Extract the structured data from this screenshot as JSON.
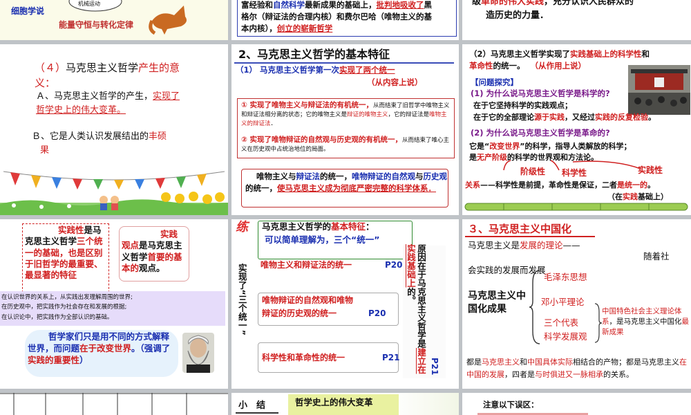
{
  "s1": {
    "cell_left": "细胞学说",
    "cell_right": "能量守恒与转化定律",
    "small_caption": "机械运动"
  },
  "s2": {
    "line1_a": "富经验和",
    "line1_b": "自然科学",
    "line1_c": "最新成果的基础上，",
    "line1_d": "批判地吸收了",
    "line1_e": "黑",
    "line2": "格尔（辩证法的合理内核）和费尔巴哈（唯物主义的基",
    "line3_a": "本内核），",
    "line3_b": "创立的崭新哲学"
  },
  "s3": {
    "line1_a": "级",
    "line1_b": "革命的伟大实践",
    "line1_c": "，充分认识人民群众的",
    "line2": "造历史的力量．"
  },
  "s4": {
    "title_a": "（４）",
    "title_b": "马克思主义哲学",
    "title_c": "产生的意",
    "title_d": "义：",
    "a_pre": "Ａ、马克思主义哲学的产生，",
    "a_red1": "实现了",
    "a_red2": "哲学史上的伟大变革。",
    "b_pre": "Ｂ、它是人类认识发展结出的",
    "b_red1": "丰硕",
    "b_red2": "果"
  },
  "s5": {
    "heading": "2、马克思主义哲学的基本特征",
    "sub_num": "（1）",
    "sub_a": "马克思主义哲学第一次",
    "sub_b": "实现了两个统一",
    "sub_note": "（从内容上说）",
    "p1_title": "① 实现了唯物主义与辩证法的有机统一，",
    "p1_body1": "从而结束了旧哲学中唯物主义和辩证法相分离的状态；它的唯物主义是",
    "p1_red1": "辩证的唯物主义",
    "p1_body2": "，它的辩证法是",
    "p1_red2": "唯物主义的辩证法",
    "p1_end": "．",
    "p2_title": "② 实现了唯物辩证的自然观与历史观的有机统一，",
    "p2_body": "从而结束了唯心主义在历史观中占统治地位的局面。",
    "p3_a": "唯物主义",
    "p3_b": "与",
    "p3_c": "辩证法",
    "p3_d": "的统一，",
    "p3_e": "唯物辩证的自然观",
    "p3_f": "与",
    "p3_g": "历史观",
    "p3_h": "的统一，",
    "p3_i": "使马克思主义成为彻底严密完整的科学体系．"
  },
  "s6": {
    "line1_a": "（2）马克思主义哲学实现了",
    "line1_b": "实践基础上的",
    "line1_c": "科学性",
    "line1_d": "和",
    "line2_a": "革命性",
    "line2_b": "的统一。",
    "line2_c": "（从作用上说）",
    "qtitle": "【问题探究】",
    "q1": "(1) 为什么说马克思主义哲学是科学的?",
    "a1": "在于它坚持科学的实践观点；",
    "a2_a": "在于它的全部理论",
    "a2_b": "源于实践",
    "a2_c": "，又经过",
    "a2_d": "实践的反复检验",
    "a2_e": "。",
    "q2": "(2) 为什么说马克思主义哲学是革命的?",
    "r1_a": "它是“",
    "r1_b": "改变世界",
    "r1_c": "”的科学，指导人类解放的科学；",
    "r2_a": "是",
    "r2_b": "无产阶级",
    "r2_c": "的科学的世界观和方法论。",
    "lab1": "阶级性",
    "lab2": "科学性",
    "lab3": "实践性",
    "rel_a": "关系",
    "rel_b": "——科学性是前提，革命性是保证，二者",
    "rel_c": "是统一的",
    "rel_d": "。",
    "rel_e": "（在",
    "rel_f": "实践",
    "rel_g": "基础上）"
  },
  "s7": {
    "b1_a": "实践性",
    "b1_b": "是",
    "b1_c": "马克思主义哲学",
    "b1_d": "三个统一的基础，也是区别于旧哲学的最重要、最显著的特征",
    "b2_a": "实践",
    "b2_b": "观点",
    "b2_c": "是马克思主义哲学",
    "b2_d": "首要的基本的",
    "b2_e": "观点。",
    "l1": "在认识世界的关系上，从实践出发理解周围的世界;",
    "l2": "在历史观中，把实践作为社会存在和发展的根据;",
    "l3": "在认识论中，把实践作为全部认识的基础。",
    "q_a": "哲学家们只是用不同的方式解释世界，而问题",
    "q_b": "在于改变世界",
    "q_c": "。（强调了",
    "q_d": "实践的重要性",
    "q_e": "）"
  },
  "s8": {
    "badge": "练",
    "box_a": "马克思主义哲学的",
    "box_b": "基本特征",
    "box_c": "：",
    "box_d": "可以简单理解为，三个“统一”",
    "left_v": "实现了“三个统一”",
    "item1": "唯物主义和辩证法的统一",
    "page1": "P20",
    "item2_a": "唯物辩证的自然观和唯物",
    "item2_b": "辩证的历史观的统一",
    "page2": "P20",
    "item3": "科学性和革命性的统一",
    "page3": "P21",
    "right_v_a": "原因在于马克思主义哲学",
    "right_v_b": "是",
    "right_v_c": "建立在实践基础上",
    "right_v_d": "的。",
    "right_page": "P21"
  },
  "s9": {
    "title": "３、马克思主义中国化",
    "line1_a": "马克思主义是",
    "line1_b": "发展的理论",
    "line1_c": "——",
    "line1_d": "随着社",
    "line2": "会实践的发展而发展",
    "main": "马克思主义中国化成果",
    "i1": "毛泽东思想",
    "i2": "邓小平理论",
    "i3": "三个代表",
    "i4": "科学发展观",
    "note_a": "中国",
    "note_b": "特色社会主义理论",
    "note_c": "体系",
    "note_d": "，是马克思主义中国化",
    "note_e": "最新成果",
    "bot_a": "都是",
    "bot_b": "马克思主义",
    "bot_c": "和",
    "bot_d": "中国具体实际",
    "bot_e": "相结合的产物；都是马克思主义",
    "bot_f": "在中国的发展",
    "bot_g": "，四者是",
    "bot_h": "与时俱进又一脉相承",
    "bot_i": "的关系。"
  },
  "s11": {
    "a": "小　结",
    "b": "哲学史上的伟大变革"
  },
  "s12": {
    "a": "注意以下误区："
  }
}
